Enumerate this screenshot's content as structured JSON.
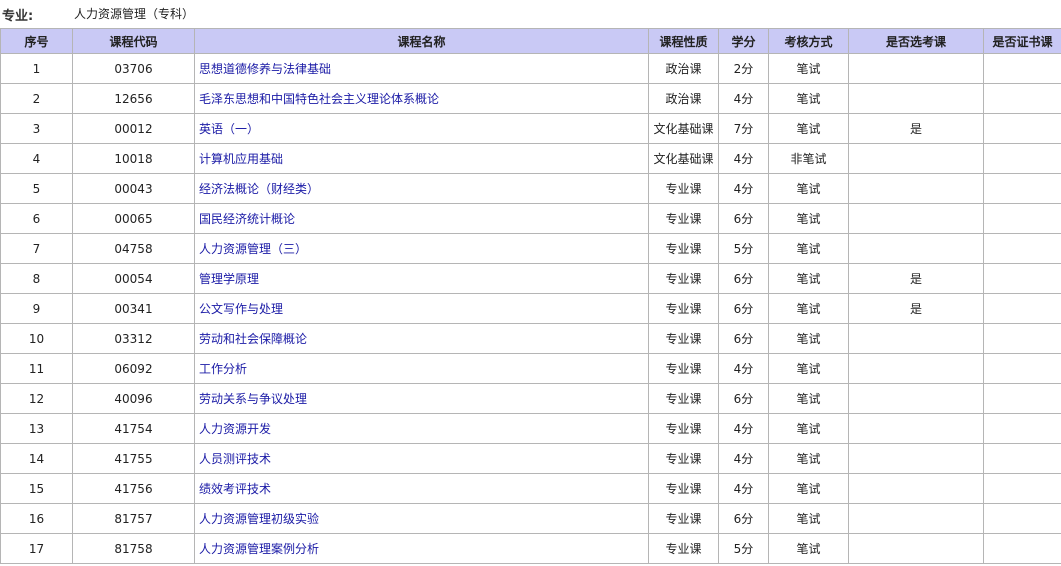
{
  "major": {
    "label": "专业:",
    "value": "人力资源管理（专科）"
  },
  "headers": [
    "序号",
    "课程代码",
    "课程名称",
    "课程性质",
    "学分",
    "考核方式",
    "是否选考课",
    "是否证书课"
  ],
  "rows": [
    {
      "no": "1",
      "code": "03706",
      "name": "思想道德修养与法律基础",
      "type": "政治课",
      "credit": "2分",
      "exam": "笔试",
      "elective": "",
      "cert": ""
    },
    {
      "no": "2",
      "code": "12656",
      "name": "毛泽东思想和中国特色社会主义理论体系概论",
      "type": "政治课",
      "credit": "4分",
      "exam": "笔试",
      "elective": "",
      "cert": ""
    },
    {
      "no": "3",
      "code": "00012",
      "name": "英语（一）",
      "type": "文化基础课",
      "credit": "7分",
      "exam": "笔试",
      "elective": "是",
      "cert": ""
    },
    {
      "no": "4",
      "code": "10018",
      "name": "计算机应用基础",
      "type": "文化基础课",
      "credit": "4分",
      "exam": "非笔试",
      "elective": "",
      "cert": ""
    },
    {
      "no": "5",
      "code": "00043",
      "name": "经济法概论（财经类）",
      "type": "专业课",
      "credit": "4分",
      "exam": "笔试",
      "elective": "",
      "cert": ""
    },
    {
      "no": "6",
      "code": "00065",
      "name": "国民经济统计概论",
      "type": "专业课",
      "credit": "6分",
      "exam": "笔试",
      "elective": "",
      "cert": ""
    },
    {
      "no": "7",
      "code": "04758",
      "name": "人力资源管理（三）",
      "type": "专业课",
      "credit": "5分",
      "exam": "笔试",
      "elective": "",
      "cert": ""
    },
    {
      "no": "8",
      "code": "00054",
      "name": "管理学原理",
      "type": "专业课",
      "credit": "6分",
      "exam": "笔试",
      "elective": "是",
      "cert": ""
    },
    {
      "no": "9",
      "code": "00341",
      "name": "公文写作与处理",
      "type": "专业课",
      "credit": "6分",
      "exam": "笔试",
      "elective": "是",
      "cert": ""
    },
    {
      "no": "10",
      "code": "03312",
      "name": "劳动和社会保障概论",
      "type": "专业课",
      "credit": "6分",
      "exam": "笔试",
      "elective": "",
      "cert": ""
    },
    {
      "no": "11",
      "code": "06092",
      "name": "工作分析",
      "type": "专业课",
      "credit": "4分",
      "exam": "笔试",
      "elective": "",
      "cert": ""
    },
    {
      "no": "12",
      "code": "40096",
      "name": "劳动关系与争议处理",
      "type": "专业课",
      "credit": "6分",
      "exam": "笔试",
      "elective": "",
      "cert": ""
    },
    {
      "no": "13",
      "code": "41754",
      "name": "人力资源开发",
      "type": "专业课",
      "credit": "4分",
      "exam": "笔试",
      "elective": "",
      "cert": ""
    },
    {
      "no": "14",
      "code": "41755",
      "name": "人员测评技术",
      "type": "专业课",
      "credit": "4分",
      "exam": "笔试",
      "elective": "",
      "cert": ""
    },
    {
      "no": "15",
      "code": "41756",
      "name": "绩效考评技术",
      "type": "专业课",
      "credit": "4分",
      "exam": "笔试",
      "elective": "",
      "cert": ""
    },
    {
      "no": "16",
      "code": "81757",
      "name": "人力资源管理初级实验",
      "type": "专业课",
      "credit": "6分",
      "exam": "笔试",
      "elective": "",
      "cert": ""
    },
    {
      "no": "17",
      "code": "81758",
      "name": "人力资源管理案例分析",
      "type": "专业课",
      "credit": "5分",
      "exam": "笔试",
      "elective": "",
      "cert": ""
    }
  ]
}
